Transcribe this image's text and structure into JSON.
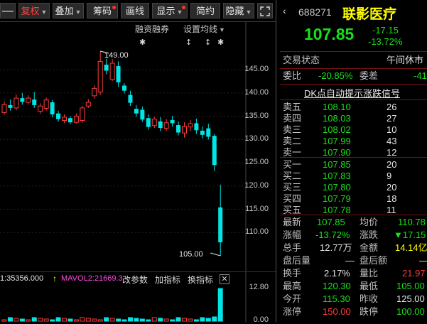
{
  "toolbar": {
    "buttons": [
      {
        "label": "复权",
        "active": true,
        "dropdown": true
      },
      {
        "label": "叠加",
        "dropdown": true
      },
      {
        "label": "筹码",
        "dot": true
      },
      {
        "label": "画线"
      },
      {
        "label": "显示",
        "dot": true
      },
      {
        "label": "简约"
      },
      {
        "label": "隐藏",
        "dropdown": true
      }
    ],
    "expand_icon": "expand-icon"
  },
  "chart": {
    "sub_labels": {
      "margin": "融资融券",
      "ma_setting": "设置均线"
    },
    "price_axis": [
      "145.00",
      "140.00",
      "135.00",
      "130.00",
      "125.00",
      "120.00",
      "115.00",
      "110.00"
    ],
    "high_marker": "149.00",
    "low_marker": "105.00",
    "volume": {
      "vol1_label": "1:35356.000",
      "mavol2_label": "MAVOL2:21669.3",
      "buttons": [
        "改参数",
        "加指标",
        "换指标"
      ],
      "axis": [
        "12.80",
        "0.00"
      ]
    },
    "candles": [
      {
        "o": 135.8,
        "c": 137.5,
        "h": 138.2,
        "l": 135.3
      },
      {
        "o": 137.4,
        "c": 136.8,
        "h": 138.6,
        "l": 136.2
      },
      {
        "o": 136.8,
        "c": 138.9,
        "h": 139.7,
        "l": 136.3
      },
      {
        "o": 138.9,
        "c": 138.1,
        "h": 140.0,
        "l": 137.5
      },
      {
        "o": 138.0,
        "c": 138.9,
        "h": 139.5,
        "l": 137.5
      },
      {
        "o": 138.6,
        "c": 137.4,
        "h": 140.2,
        "l": 136.8
      },
      {
        "o": 136.1,
        "c": 137.2,
        "h": 137.8,
        "l": 135.5
      },
      {
        "o": 136.7,
        "c": 138.5,
        "h": 139.0,
        "l": 136.2
      },
      {
        "o": 138.0,
        "c": 135.4,
        "h": 138.5,
        "l": 134.8
      },
      {
        "o": 135.6,
        "c": 134.4,
        "h": 136.2,
        "l": 133.8
      },
      {
        "o": 134.1,
        "c": 134.8,
        "h": 135.4,
        "l": 133.5
      },
      {
        "o": 134.6,
        "c": 133.7,
        "h": 135.0,
        "l": 133.3
      },
      {
        "o": 133.7,
        "c": 135.0,
        "h": 135.6,
        "l": 133.4
      },
      {
        "o": 134.1,
        "c": 136.8,
        "h": 137.3,
        "l": 133.6
      },
      {
        "o": 137.2,
        "c": 138.0,
        "h": 138.7,
        "l": 136.8
      },
      {
        "o": 139.4,
        "c": 141.0,
        "h": 141.7,
        "l": 138.8
      },
      {
        "o": 140.2,
        "c": 146.8,
        "h": 149.0,
        "l": 139.6
      },
      {
        "o": 146.1,
        "c": 144.8,
        "h": 147.4,
        "l": 144.0
      },
      {
        "o": 142.9,
        "c": 146.4,
        "h": 147.3,
        "l": 142.6
      },
      {
        "o": 145.8,
        "c": 142.3,
        "h": 146.8,
        "l": 141.3
      },
      {
        "o": 141.6,
        "c": 140.5,
        "h": 142.1,
        "l": 139.9
      },
      {
        "o": 139.6,
        "c": 137.9,
        "h": 140.5,
        "l": 137.2
      },
      {
        "o": 136.6,
        "c": 135.6,
        "h": 137.4,
        "l": 134.9
      },
      {
        "o": 136.4,
        "c": 134.3,
        "h": 137.1,
        "l": 133.8
      },
      {
        "o": 134.6,
        "c": 132.7,
        "h": 135.4,
        "l": 132.1
      },
      {
        "o": 133.0,
        "c": 134.4,
        "h": 134.9,
        "l": 132.5
      },
      {
        "o": 133.9,
        "c": 132.5,
        "h": 134.8,
        "l": 131.8
      },
      {
        "o": 132.4,
        "c": 133.6,
        "h": 134.4,
        "l": 131.9
      },
      {
        "o": 134.2,
        "c": 133.5,
        "h": 135.1,
        "l": 132.8
      },
      {
        "o": 133.1,
        "c": 131.5,
        "h": 133.9,
        "l": 130.9
      },
      {
        "o": 131.4,
        "c": 132.8,
        "h": 133.7,
        "l": 130.4
      },
      {
        "o": 132.7,
        "c": 133.4,
        "h": 134.2,
        "l": 131.8
      },
      {
        "o": 133.5,
        "c": 132.0,
        "h": 134.5,
        "l": 131.2
      },
      {
        "o": 131.9,
        "c": 131.0,
        "h": 132.8,
        "l": 130.2
      },
      {
        "o": 132.4,
        "c": 130.6,
        "h": 133.4,
        "l": 130.0
      },
      {
        "o": 130.8,
        "c": 124.5,
        "h": 131.2,
        "l": 123.2
      },
      {
        "o": 115.4,
        "c": 107.9,
        "h": 120.3,
        "l": 105.0
      }
    ]
  },
  "quote": {
    "code": "688271",
    "name": "联影医疗",
    "price": "107.85",
    "change": "-17.15",
    "change_pct": "-13.72%",
    "status_label": "交易状态",
    "status_value": "午间休市",
    "weibi_label": "委比",
    "weibi_value": "-20.85%",
    "weicha_label": "委差",
    "weicha_value": "-41",
    "signal_link": "DK点自动提示涨跌信号"
  },
  "order_book": {
    "asks": [
      {
        "label": "卖五",
        "price": "108.10",
        "vol": "26"
      },
      {
        "label": "卖四",
        "price": "108.03",
        "vol": "27"
      },
      {
        "label": "卖三",
        "price": "108.02",
        "vol": "10"
      },
      {
        "label": "卖二",
        "price": "107.99",
        "vol": "43"
      },
      {
        "label": "卖一",
        "price": "107.90",
        "vol": "12"
      }
    ],
    "bids": [
      {
        "label": "买一",
        "price": "107.85",
        "vol": "20"
      },
      {
        "label": "买二",
        "price": "107.83",
        "vol": "9"
      },
      {
        "label": "买三",
        "price": "107.80",
        "vol": "20"
      },
      {
        "label": "买四",
        "price": "107.79",
        "vol": "18"
      },
      {
        "label": "买五",
        "price": "107.78",
        "vol": "11"
      }
    ]
  },
  "stats": {
    "latest": {
      "label": "最新",
      "value": "107.85"
    },
    "avg": {
      "label": "均价",
      "value": "110.78"
    },
    "chg_pct": {
      "label": "涨幅",
      "value": "-13.72%"
    },
    "chg": {
      "label": "涨跌",
      "value": "▼17.15"
    },
    "total_hand": {
      "label": "总手",
      "value": "12.77万"
    },
    "amount": {
      "label": "金额",
      "value": "14.14亿"
    },
    "after_vol": {
      "label": "盘后量",
      "value": "—"
    },
    "after_amt": {
      "label": "盘后额",
      "value": "—"
    },
    "turnover": {
      "label": "换手",
      "value": "2.17%"
    },
    "vol_ratio": {
      "label": "量比",
      "value": "21.97"
    },
    "high": {
      "label": "最高",
      "value": "120.30"
    },
    "low": {
      "label": "最低",
      "value": "105.00"
    },
    "open": {
      "label": "今开",
      "value": "115.30"
    },
    "prev_close": {
      "label": "昨收",
      "value": "125.00"
    },
    "limit_up": {
      "label": "涨停",
      "value": "150.00"
    },
    "limit_down": {
      "label": "跌停",
      "value": "100.00"
    }
  },
  "colors": {
    "up": "#ff3c3c",
    "down": "#00e5e5",
    "accent": "#ffff00",
    "green": "#18e018"
  }
}
